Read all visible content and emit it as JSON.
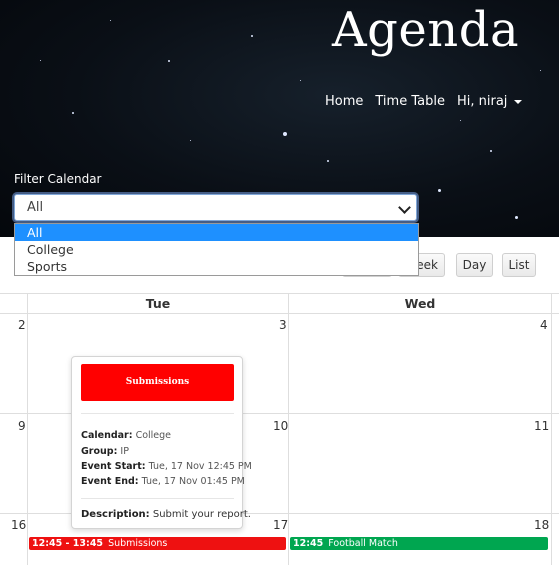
{
  "brand": "Agenda",
  "nav": {
    "home": "Home",
    "timetable": "Time Table",
    "user_menu": "Hi, niraj"
  },
  "filter": {
    "label": "Filter Calendar",
    "selected": "All",
    "options": [
      "All",
      "College",
      "Sports"
    ]
  },
  "toolbar": {
    "week_label": "Week",
    "day_label": "Day",
    "list_label": "List"
  },
  "calendar": {
    "days_of_week": [
      "Tue",
      "Wed"
    ],
    "dates": [
      "2",
      "3",
      "4",
      "9",
      "10",
      "11",
      "16",
      "17",
      "18"
    ],
    "events": [
      {
        "time": "12:45 - 13:45",
        "title": "Submissions",
        "color": "#ee1111"
      },
      {
        "time": "12:45",
        "title": "Football Match",
        "color": "#00a650"
      }
    ]
  },
  "popover": {
    "title": "Submissions",
    "calendar_key": "Calendar:",
    "calendar_val": "College",
    "group_key": "Group:",
    "group_val": "IP",
    "start_key": "Event Start:",
    "start_val": "Tue, 17 Nov 12:45 PM",
    "end_key": "Event End:",
    "end_val": "Tue, 17 Nov 01:45 PM",
    "desc_key": "Description:",
    "desc_val": "Submit your report."
  },
  "colors": {
    "accent_selected": "#1e90ff",
    "event_red": "#ee1111",
    "event_green": "#00a650",
    "popover_header": "#ff0000"
  }
}
